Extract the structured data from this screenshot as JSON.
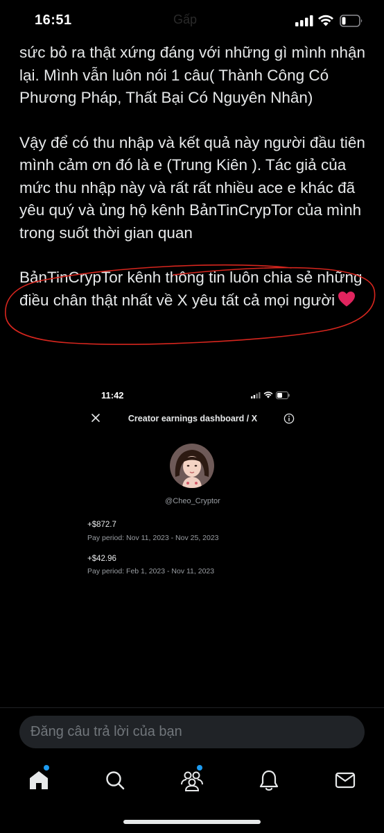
{
  "status_bar": {
    "time": "16:51",
    "background_app_text": "Gấp"
  },
  "post": {
    "paragraphs": [
      "sức bỏ ra thật xứng đáng với những gì mình nhận lại. Mình vẫn luôn nói 1 câu( Thành Công Có Phương Pháp, Thất Bại Có Nguyên Nhân)",
      "Vậy để có thu nhập và kết quả này người đầu tiên mình cảm ơn đó là e (Trung Kiên ). Tác giả của mức thu nhập này và rất rất nhiều ace e khác đã yêu quý và ủng hộ kênh BảnTinCrypTor của mình trong suốt thời gian quan",
      "BảnTinCrypTor kênh thông tin luôn chia sẻ những điều chân thật nhất về X yêu tất cả mọi người"
    ],
    "highlight_color": "#d7261e",
    "heart_color": "#e0245e"
  },
  "embed": {
    "time": "11:42",
    "title": "Creator earnings dashboard / X",
    "handle": "@Cheo_Cryptor",
    "earnings": [
      {
        "amount": "+$872.7",
        "period": "Pay period: Nov 11, 2023 - Nov 25, 2023"
      },
      {
        "amount": "+$42.96",
        "period": "Pay period: Feb 1, 2023 - Nov 11, 2023"
      }
    ]
  },
  "reply": {
    "placeholder": "Đăng câu trả lời của bạn"
  },
  "tabs": [
    {
      "icon": "home-icon",
      "has_badge": true
    },
    {
      "icon": "search-icon",
      "has_badge": false
    },
    {
      "icon": "communities-icon",
      "has_badge": true
    },
    {
      "icon": "bell-icon",
      "has_badge": false
    },
    {
      "icon": "mail-icon",
      "has_badge": false
    }
  ],
  "colors": {
    "background": "#000000",
    "text": "#e7e9ea",
    "muted": "#71767b",
    "accent": "#1d9bf0"
  }
}
